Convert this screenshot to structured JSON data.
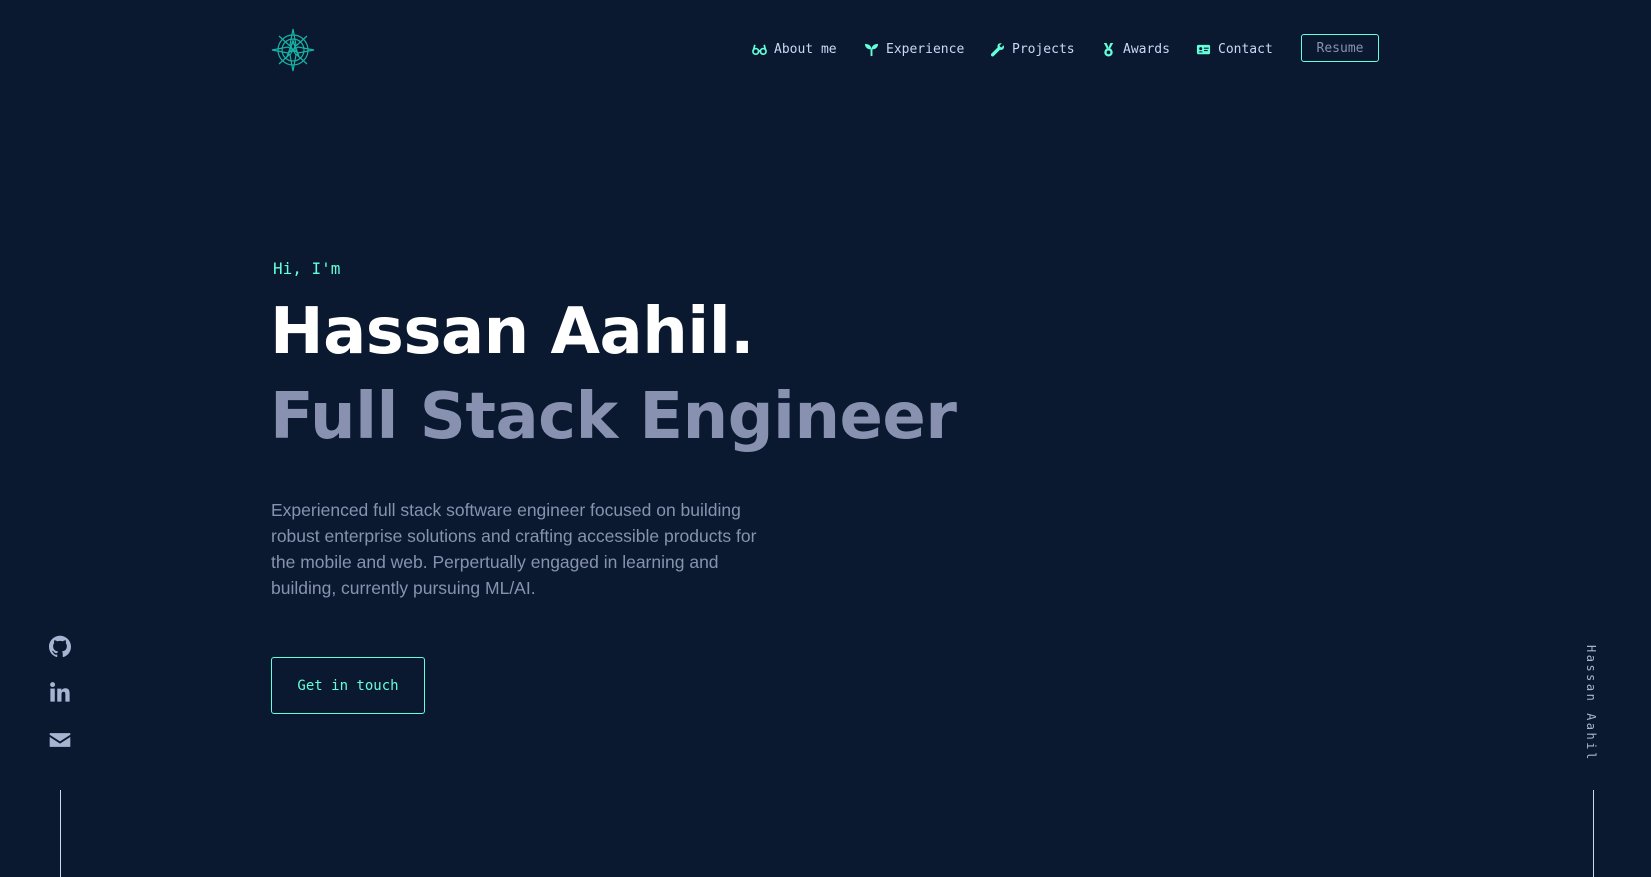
{
  "header": {
    "logo_icon": "compass-logo-icon",
    "nav": [
      {
        "label": "About me",
        "icon": "glasses-icon"
      },
      {
        "label": "Experience",
        "icon": "sprout-icon"
      },
      {
        "label": "Projects",
        "icon": "wrench-icon"
      },
      {
        "label": "Awards",
        "icon": "medal-icon"
      },
      {
        "label": "Contact",
        "icon": "id-card-icon"
      }
    ],
    "resume_label": "Resume"
  },
  "hero": {
    "greeting": "Hi, I'm",
    "name": "Hassan Aahil.",
    "role": "Full Stack Engineer",
    "intro": "Experienced full stack software engineer focused on building robust enterprise solutions and crafting accessible products for the mobile and web. Perpertually engaged in learning and building, currently pursuing ML/AI.",
    "cta_label": "Get in touch"
  },
  "sidebar": {
    "social": [
      {
        "icon": "github-icon"
      },
      {
        "icon": "linkedin-icon"
      },
      {
        "icon": "mail-icon"
      }
    ],
    "vertical_name": "Hassan Aahil"
  },
  "colors": {
    "background": "#0a192f",
    "accent": "#64ffda",
    "heading": "#ffffff",
    "muted": "#8892b0",
    "light": "#ccd6f6"
  }
}
